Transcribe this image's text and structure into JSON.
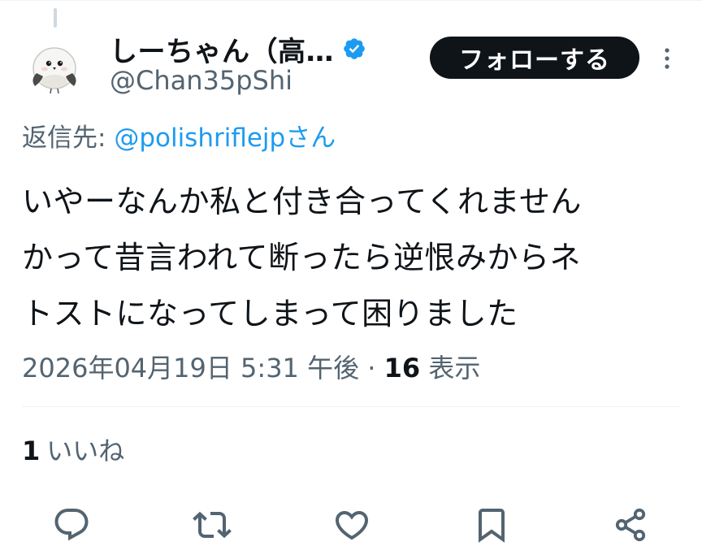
{
  "tweet": {
    "author": {
      "display_name": "しーちゃん（高…",
      "handle": "@Chan35pShi",
      "verified": true
    },
    "follow_label": "フォローする",
    "reply_to": {
      "prefix": "返信先: ",
      "mention": "@polishriflejp",
      "suffix": "さん"
    },
    "text_lines": [
      "いやーなんか私と付き合ってくれません",
      "かって昔言われて断ったら逆恨みからネ",
      "トストになってしまって困りました"
    ],
    "timestamp": "2026年04月19日 5:31 午後",
    "separator": " · ",
    "views_count": "16",
    "views_label": " 表示",
    "likes_count": "1",
    "likes_label": "いいね"
  },
  "icons": {
    "verified": "verified-badge-icon",
    "more": "more-vertical-icon",
    "reply": "reply-icon",
    "retweet": "retweet-icon",
    "like": "like-heart-icon",
    "bookmark": "bookmark-icon",
    "share": "share-icon"
  },
  "colors": {
    "accent_blue": "#1d9bf0",
    "text_primary": "#0f1419",
    "text_secondary": "#536471",
    "follow_bg": "#0f1419",
    "action_icon": "#536471"
  }
}
